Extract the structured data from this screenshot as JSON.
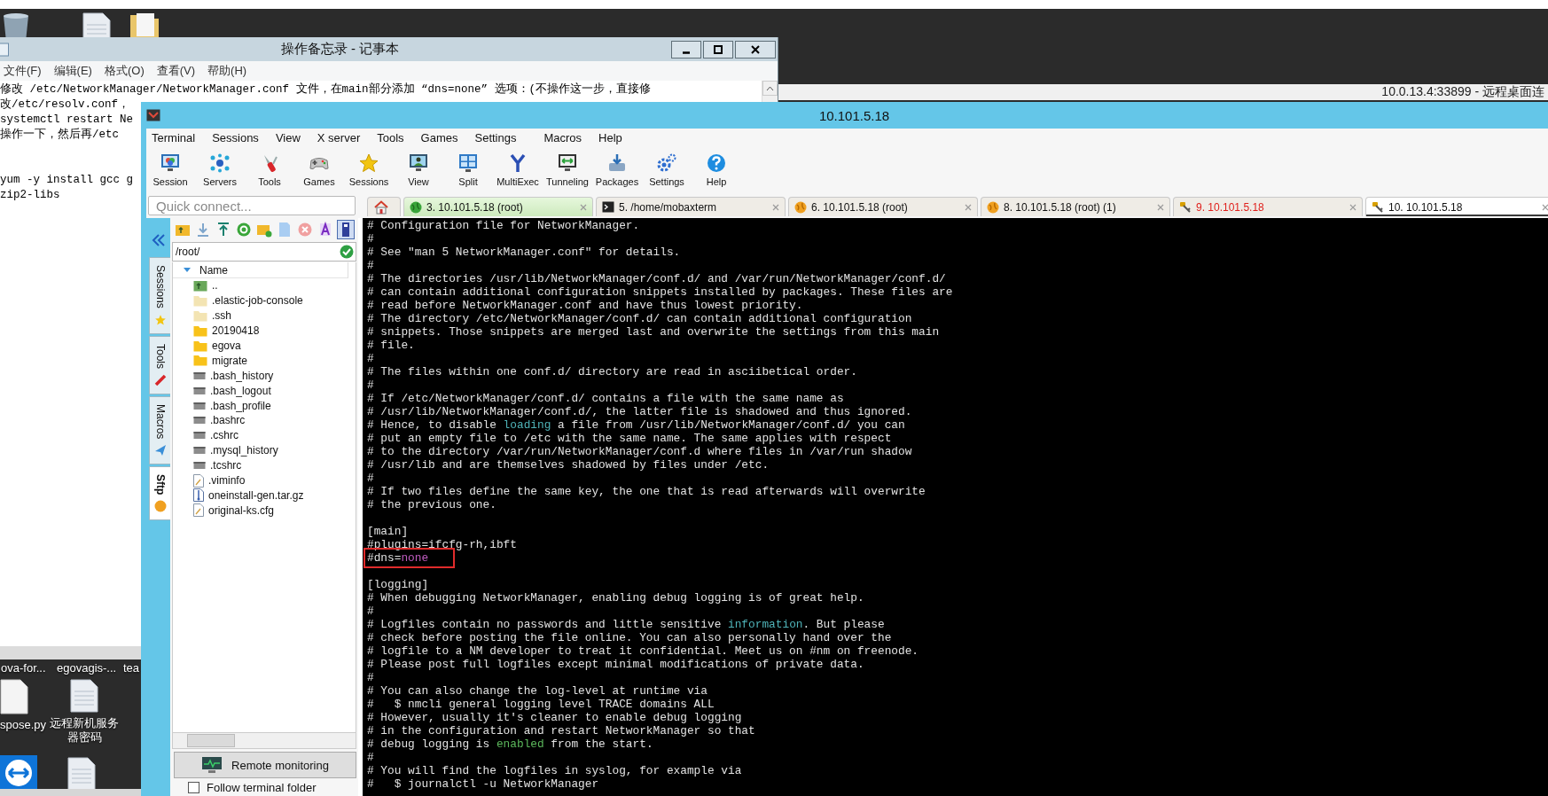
{
  "desktop": {
    "icons": [
      {
        "kind": "trash"
      },
      {
        "kind": "text-file"
      },
      {
        "kind": "folder"
      },
      {
        "kind": "label-only",
        "label": "ova-for..."
      },
      {
        "kind": "label-only",
        "label": "egovagis-..."
      },
      {
        "kind": "label-only",
        "label": "tea"
      },
      {
        "kind": "blank-file",
        "label": "spose.py"
      },
      {
        "kind": "text-file",
        "label": "远程新机服务器密码"
      },
      {
        "kind": "remote-app"
      },
      {
        "kind": "text-file"
      }
    ]
  },
  "notepad": {
    "title": "操作备忘录 - 记事本",
    "menu": [
      "文件(F)",
      "编辑(E)",
      "格式(O)",
      "查看(V)",
      "帮助(H)"
    ],
    "paragraphs": [
      [
        "修改 /etc/NetworkManager/NetworkManager.conf 文件，在main部分添加 “dns=none” 选项：(不操作这一步，直接修",
        "改/etc/resolv.conf，",
        "systemctl restart Ne",
        "操作一下，然后再/etc"
      ],
      [
        "yum -y install gcc g",
        "zip2-libs"
      ]
    ]
  },
  "remote_desktop": {
    "title": "10.0.13.4:33899 - 远程桌面连"
  },
  "mobaxterm": {
    "title": "10.101.5.18",
    "menu": [
      "Terminal",
      "Sessions",
      "View",
      "X server",
      "Tools",
      "Games",
      "Settings",
      "Macros",
      "Help"
    ],
    "toolbar": [
      "Session",
      "Servers",
      "Tools",
      "Games",
      "Sessions",
      "View",
      "Split",
      "MultiExec",
      "Tunneling",
      "Packages",
      "Settings",
      "Help"
    ],
    "quick_connect": {
      "placeholder": "Quick connect..."
    },
    "tabs": [
      {
        "kind": "home",
        "selected": false
      },
      {
        "kind": "ssh-active",
        "label": "3. 10.101.5.18 (root)",
        "selected": false
      },
      {
        "kind": "shell",
        "label": "5. /home/mobaxterm",
        "selected": false
      },
      {
        "kind": "ssh",
        "label": "6. 10.101.5.18 (root)",
        "selected": false
      },
      {
        "kind": "ssh",
        "label": "8. 10.101.5.18 (root) (1)",
        "selected": false
      },
      {
        "kind": "ssh-closed",
        "label": "9. 10.101.5.18",
        "selected": false
      },
      {
        "kind": "ssh-key",
        "label": "10. 10.101.5.18",
        "selected": true
      }
    ],
    "side_tabs": [
      {
        "label": "Sessions",
        "selected": false
      },
      {
        "label": "Tools",
        "selected": false
      },
      {
        "label": "Macros",
        "selected": false
      },
      {
        "label": "Sftp",
        "selected": true
      }
    ],
    "sftp": {
      "path": "/root/",
      "columns": [
        "Name"
      ],
      "files": [
        {
          "kind": "parent",
          "name": ".."
        },
        {
          "kind": "hidden-folder",
          "name": ".elastic-job-console"
        },
        {
          "kind": "hidden-folder",
          "name": ".ssh"
        },
        {
          "kind": "folder",
          "name": "20190418"
        },
        {
          "kind": "folder",
          "name": "egova"
        },
        {
          "kind": "folder",
          "name": "migrate"
        },
        {
          "kind": "file",
          "name": ".bash_history"
        },
        {
          "kind": "file",
          "name": ".bash_logout"
        },
        {
          "kind": "file",
          "name": ".bash_profile"
        },
        {
          "kind": "file",
          "name": ".bashrc"
        },
        {
          "kind": "file",
          "name": ".cshrc"
        },
        {
          "kind": "file",
          "name": ".mysql_history"
        },
        {
          "kind": "file",
          "name": ".tcshrc"
        },
        {
          "kind": "text",
          "name": ".viminfo"
        },
        {
          "kind": "archive",
          "name": "oneinstall-gen.tar.gz"
        },
        {
          "kind": "text",
          "name": "original-ks.cfg"
        }
      ],
      "monitor_button": "Remote monitoring",
      "follow_folder": {
        "label": "Follow terminal folder",
        "checked": false
      }
    },
    "terminal": {
      "lines": [
        {
          "boxed": false,
          "segments": [
            {
              "text": "# Configuration file for NetworkManager."
            }
          ]
        },
        {
          "boxed": false,
          "segments": [
            {
              "text": "#"
            }
          ]
        },
        {
          "boxed": false,
          "segments": [
            {
              "text": "# See \"man 5 NetworkManager.conf\" for details."
            }
          ]
        },
        {
          "boxed": false,
          "segments": [
            {
              "text": "#"
            }
          ]
        },
        {
          "boxed": false,
          "segments": [
            {
              "text": "# The directories /usr/lib/NetworkManager/conf.d/ and /var/run/NetworkManager/conf.d/"
            }
          ]
        },
        {
          "boxed": false,
          "segments": [
            {
              "text": "# can contain additional configuration snippets installed by packages. These files are"
            }
          ]
        },
        {
          "boxed": false,
          "segments": [
            {
              "text": "# read before NetworkManager.conf and have thus lowest priority."
            }
          ]
        },
        {
          "boxed": false,
          "segments": [
            {
              "text": "# The directory /etc/NetworkManager/conf.d/ can contain additional configuration"
            }
          ]
        },
        {
          "boxed": false,
          "segments": [
            {
              "text": "# snippets. Those snippets are merged last and overwrite the settings from this main"
            }
          ]
        },
        {
          "boxed": false,
          "segments": [
            {
              "text": "# file."
            }
          ]
        },
        {
          "boxed": false,
          "segments": [
            {
              "text": "#"
            }
          ]
        },
        {
          "boxed": false,
          "segments": [
            {
              "text": "# The files within one conf.d/ directory are read in asciibetical order."
            }
          ]
        },
        {
          "boxed": false,
          "segments": [
            {
              "text": "#"
            }
          ]
        },
        {
          "boxed": false,
          "segments": [
            {
              "text": "# If /etc/NetworkManager/conf.d/ contains a file with the same name as"
            }
          ]
        },
        {
          "boxed": false,
          "segments": [
            {
              "text": "# /usr/lib/NetworkManager/conf.d/, the latter file is shadowed and thus ignored."
            }
          ]
        },
        {
          "boxed": false,
          "segments": [
            {
              "text": "# Hence, to disable "
            },
            {
              "text": "loading",
              "color": "#4fb3b8"
            },
            {
              "text": " a file from /usr/lib/NetworkManager/conf.d/ you can"
            }
          ]
        },
        {
          "boxed": false,
          "segments": [
            {
              "text": "# put an empty file to /etc with the same name. The same applies with respect"
            }
          ]
        },
        {
          "boxed": false,
          "segments": [
            {
              "text": "# to the directory /var/run/NetworkManager/conf.d where files in /var/run shadow"
            }
          ]
        },
        {
          "boxed": false,
          "segments": [
            {
              "text": "# /usr/lib and are themselves shadowed by files under /etc."
            }
          ]
        },
        {
          "boxed": false,
          "segments": [
            {
              "text": "#"
            }
          ]
        },
        {
          "boxed": false,
          "segments": [
            {
              "text": "# If two files define the same key, the one that is read afterwards will overwrite"
            }
          ]
        },
        {
          "boxed": false,
          "segments": [
            {
              "text": "# the previous one."
            }
          ]
        },
        {
          "boxed": false
        },
        {
          "boxed": false,
          "segments": [
            {
              "text": "[main]"
            }
          ]
        },
        {
          "boxed": false,
          "segments": [
            {
              "text": "#plugins=ifcfg-rh,ibft"
            }
          ]
        },
        {
          "boxed": true,
          "segments": [
            {
              "text": "#dns="
            },
            {
              "text": "none",
              "color": "#c05cc0"
            }
          ]
        },
        {
          "boxed": false
        },
        {
          "boxed": false,
          "segments": [
            {
              "text": "[logging]"
            }
          ]
        },
        {
          "boxed": false,
          "segments": [
            {
              "text": "# When debugging NetworkManager, enabling debug logging is of great help."
            }
          ]
        },
        {
          "boxed": false,
          "segments": [
            {
              "text": "#"
            }
          ]
        },
        {
          "boxed": false,
          "segments": [
            {
              "text": "# Logfiles contain no passwords and little sensitive "
            },
            {
              "text": "information",
              "color": "#4fb3b8"
            },
            {
              "text": ". But please"
            }
          ]
        },
        {
          "boxed": false,
          "segments": [
            {
              "text": "# check before posting the file online. You can also personally hand over the"
            }
          ]
        },
        {
          "boxed": false,
          "segments": [
            {
              "text": "# logfile to a NM developer to treat it confidential. Meet us on #nm on freenode."
            }
          ]
        },
        {
          "boxed": false,
          "segments": [
            {
              "text": "# Please post full logfiles except minimal modifications of private data."
            }
          ]
        },
        {
          "boxed": false,
          "segments": [
            {
              "text": "#"
            }
          ]
        },
        {
          "boxed": false,
          "segments": [
            {
              "text": "# You can also change the log-level at runtime via"
            }
          ]
        },
        {
          "boxed": false,
          "segments": [
            {
              "text": "#   $ nmcli general logging level TRACE domains ALL"
            }
          ]
        },
        {
          "boxed": false,
          "segments": [
            {
              "text": "# However, usually it's cleaner to enable debug logging"
            }
          ]
        },
        {
          "boxed": false,
          "segments": [
            {
              "text": "# in the configuration and restart NetworkManager so that"
            }
          ]
        },
        {
          "boxed": false,
          "segments": [
            {
              "text": "# debug logging is "
            },
            {
              "text": "enabled",
              "color": "#5cb85c"
            },
            {
              "text": " from the start."
            }
          ]
        },
        {
          "boxed": false,
          "segments": [
            {
              "text": "#"
            }
          ]
        },
        {
          "boxed": false,
          "segments": [
            {
              "text": "# You will find the logfiles in syslog, for example via"
            }
          ]
        },
        {
          "boxed": false,
          "segments": [
            {
              "text": "#   $ journalctl -u NetworkManager"
            }
          ]
        }
      ]
    }
  }
}
